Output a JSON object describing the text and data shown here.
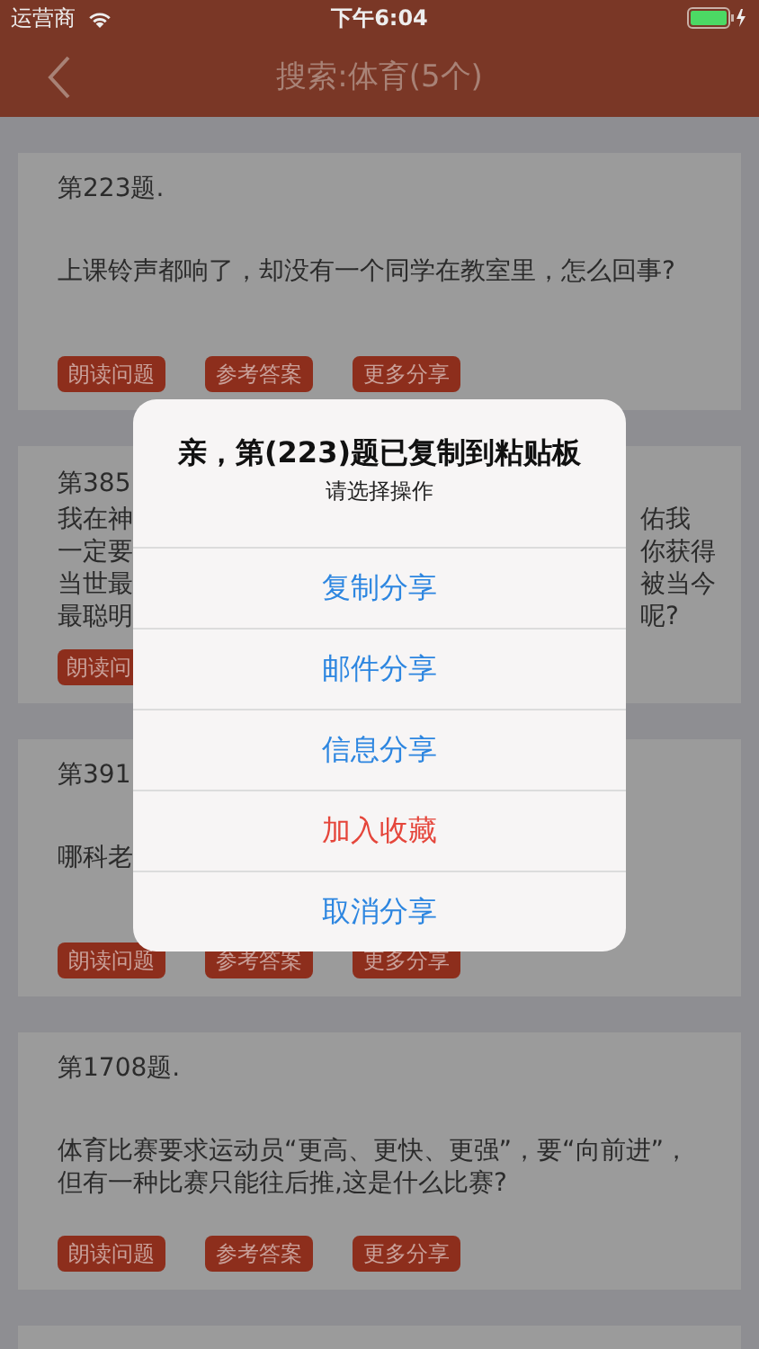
{
  "status_bar": {
    "carrier": "运营商",
    "time": "下午6:04"
  },
  "nav": {
    "title": "搜索:体育(5个)"
  },
  "cards": [
    {
      "kind": "full",
      "title": "第223题.",
      "lines": [
        "上课铃声都响了，却没有一个同学在教室里，怎么回事?"
      ],
      "buttons": [
        "朗读问题",
        "参考答案",
        "更多分享"
      ]
    },
    {
      "kind": "split",
      "title": "第385",
      "lines": [
        {
          "left": "我在神",
          "right": "佑我"
        },
        {
          "left": "一定要",
          "right": "你获得"
        },
        {
          "left": "当世最",
          "right": "被当今"
        },
        {
          "left": "最聪明",
          "right": "呢?"
        }
      ],
      "buttons": [
        "朗读问"
      ]
    },
    {
      "kind": "full",
      "title": "第391",
      "lines": [
        "哪科老"
      ],
      "buttons": [
        "朗读问题",
        "参考答案",
        "更多分享"
      ]
    },
    {
      "kind": "full",
      "title": "第1708题.",
      "lines": [
        "体育比赛要求运动员“更高、更快、更强”，要“向前进”，",
        "但有一种比赛只能往后推,这是什么比赛?"
      ],
      "buttons": [
        "朗读问题",
        "参考答案",
        "更多分享"
      ]
    },
    {
      "kind": "partial"
    }
  ],
  "dialog": {
    "title": "亲，第(223)题已复制到粘贴板",
    "message": "请选择操作",
    "actions": [
      {
        "label": "复制分享",
        "kind": "default"
      },
      {
        "label": "邮件分享",
        "kind": "default"
      },
      {
        "label": "信息分享",
        "kind": "default"
      },
      {
        "label": "加入收藏",
        "kind": "destructive"
      },
      {
        "label": "取消分享",
        "kind": "default"
      }
    ]
  }
}
